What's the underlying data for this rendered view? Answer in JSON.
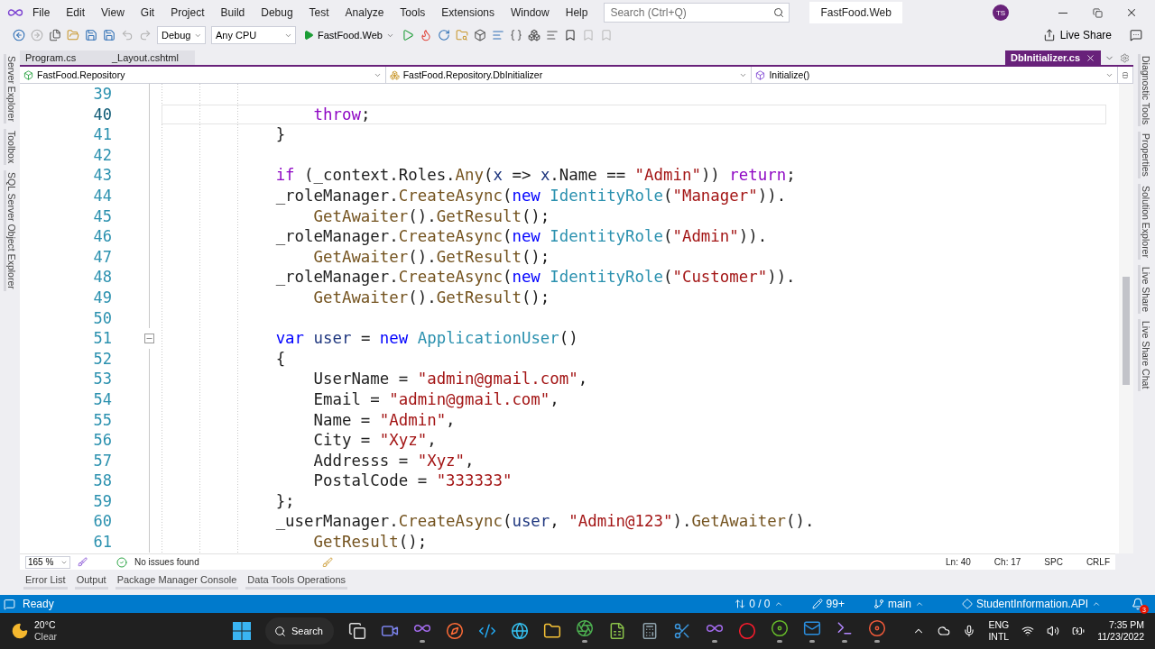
{
  "menu": [
    "File",
    "Edit",
    "View",
    "Git",
    "Project",
    "Build",
    "Debug",
    "Test",
    "Analyze",
    "Tools",
    "Extensions",
    "Window",
    "Help"
  ],
  "search": {
    "placeholder": "Search (Ctrl+Q)"
  },
  "solution_name": "FastFood.Web",
  "avatar": "TS",
  "toolbar": {
    "configuration": "Debug",
    "platform": "Any CPU",
    "run_target": "FastFood.Web",
    "live_share": "Live Share"
  },
  "left_tool_tabs": [
    "Server Explorer",
    "Toolbox",
    "SQL Server Object Explorer"
  ],
  "right_tool_tabs": [
    "Diagnostic Tools",
    "Properties",
    "Solution Explorer",
    "Live Share",
    "Live Share Chat"
  ],
  "document_tabs": [
    {
      "label": "Program.cs",
      "selected": false
    },
    {
      "label": "_Layout.cshtml",
      "selected": false
    },
    {
      "label": "DbInitializer.cs",
      "selected": true
    }
  ],
  "navigation_bar": {
    "project": "FastFood.Repository",
    "type": "FastFood.Repository.DbInitializer",
    "member": "Initialize()"
  },
  "editor": {
    "lines": [
      {
        "number": "39",
        "current": false,
        "collapsible": false
      },
      {
        "number": "40",
        "current": true,
        "collapsible": false,
        "tokens": [
          {
            "text": "                throw",
            "kind": "control"
          },
          {
            "text": ";",
            "kind": "plain"
          }
        ]
      },
      {
        "number": "41",
        "current": false,
        "collapsible": false,
        "tokens": [
          {
            "text": "            }",
            "kind": "plain"
          }
        ]
      },
      {
        "number": "42",
        "current": false,
        "collapsible": false
      },
      {
        "number": "43",
        "current": false,
        "collapsible": false,
        "tokens": [
          {
            "text": "            if",
            "kind": "control"
          },
          {
            "text": " (_context.Roles.",
            "kind": "plain"
          },
          {
            "text": "Any",
            "kind": "method"
          },
          {
            "text": "(",
            "kind": "plain"
          },
          {
            "text": "x",
            "kind": "local"
          },
          {
            "text": " => ",
            "kind": "plain"
          },
          {
            "text": "x",
            "kind": "local"
          },
          {
            "text": ".Name == ",
            "kind": "plain"
          },
          {
            "text": "\"Admin\"",
            "kind": "string"
          },
          {
            "text": ")) ",
            "kind": "plain"
          },
          {
            "text": "return",
            "kind": "control"
          },
          {
            "text": ";",
            "kind": "plain"
          }
        ]
      },
      {
        "number": "44",
        "current": false,
        "collapsible": false,
        "tokens": [
          {
            "text": "            _roleManager.",
            "kind": "plain"
          },
          {
            "text": "CreateAsync",
            "kind": "method"
          },
          {
            "text": "(",
            "kind": "plain"
          },
          {
            "text": "new",
            "kind": "keyword"
          },
          {
            "text": " IdentityRole",
            "kind": "type"
          },
          {
            "text": "(",
            "kind": "plain"
          },
          {
            "text": "\"Manager\"",
            "kind": "string"
          },
          {
            "text": ")).",
            "kind": "plain"
          }
        ]
      },
      {
        "number": "45",
        "current": false,
        "collapsible": false,
        "tokens": [
          {
            "text": "                GetAwaiter",
            "kind": "method"
          },
          {
            "text": "().",
            "kind": "plain"
          },
          {
            "text": "GetResult",
            "kind": "method"
          },
          {
            "text": "();",
            "kind": "plain"
          }
        ]
      },
      {
        "number": "46",
        "current": false,
        "collapsible": false,
        "tokens": [
          {
            "text": "            _roleManager.",
            "kind": "plain"
          },
          {
            "text": "CreateAsync",
            "kind": "method"
          },
          {
            "text": "(",
            "kind": "plain"
          },
          {
            "text": "new",
            "kind": "keyword"
          },
          {
            "text": " IdentityRole",
            "kind": "type"
          },
          {
            "text": "(",
            "kind": "plain"
          },
          {
            "text": "\"Admin\"",
            "kind": "string"
          },
          {
            "text": ")).",
            "kind": "plain"
          }
        ]
      },
      {
        "number": "47",
        "current": false,
        "collapsible": false,
        "tokens": [
          {
            "text": "                GetAwaiter",
            "kind": "method"
          },
          {
            "text": "().",
            "kind": "plain"
          },
          {
            "text": "GetResult",
            "kind": "method"
          },
          {
            "text": "();",
            "kind": "plain"
          }
        ]
      },
      {
        "number": "48",
        "current": false,
        "collapsible": false,
        "tokens": [
          {
            "text": "            _roleManager.",
            "kind": "plain"
          },
          {
            "text": "CreateAsync",
            "kind": "method"
          },
          {
            "text": "(",
            "kind": "plain"
          },
          {
            "text": "new",
            "kind": "keyword"
          },
          {
            "text": " IdentityRole",
            "kind": "type"
          },
          {
            "text": "(",
            "kind": "plain"
          },
          {
            "text": "\"Customer\"",
            "kind": "string"
          },
          {
            "text": ")).",
            "kind": "plain"
          }
        ]
      },
      {
        "number": "49",
        "current": false,
        "collapsible": false,
        "tokens": [
          {
            "text": "                GetAwaiter",
            "kind": "method"
          },
          {
            "text": "().",
            "kind": "plain"
          },
          {
            "text": "GetResult",
            "kind": "method"
          },
          {
            "text": "();",
            "kind": "plain"
          }
        ]
      },
      {
        "number": "50",
        "current": false,
        "collapsible": false
      },
      {
        "number": "51",
        "current": false,
        "collapsible": true,
        "tokens": [
          {
            "text": "            var",
            "kind": "keyword"
          },
          {
            "text": " user",
            "kind": "local"
          },
          {
            "text": " = ",
            "kind": "plain"
          },
          {
            "text": "new",
            "kind": "keyword"
          },
          {
            "text": " ApplicationUser",
            "kind": "type"
          },
          {
            "text": "()",
            "kind": "plain"
          }
        ]
      },
      {
        "number": "52",
        "current": false,
        "collapsible": false,
        "tokens": [
          {
            "text": "            {",
            "kind": "plain"
          }
        ]
      },
      {
        "number": "53",
        "current": false,
        "collapsible": false,
        "tokens": [
          {
            "text": "                UserName = ",
            "kind": "plain"
          },
          {
            "text": "\"admin@gmail.com\"",
            "kind": "string"
          },
          {
            "text": ",",
            "kind": "plain"
          }
        ]
      },
      {
        "number": "54",
        "current": false,
        "collapsible": false,
        "tokens": [
          {
            "text": "                Email = ",
            "kind": "plain"
          },
          {
            "text": "\"admin@gmail.com\"",
            "kind": "string"
          },
          {
            "text": ",",
            "kind": "plain"
          }
        ]
      },
      {
        "number": "55",
        "current": false,
        "collapsible": false,
        "tokens": [
          {
            "text": "                Name = ",
            "kind": "plain"
          },
          {
            "text": "\"Admin\"",
            "kind": "string"
          },
          {
            "text": ",",
            "kind": "plain"
          }
        ]
      },
      {
        "number": "56",
        "current": false,
        "collapsible": false,
        "tokens": [
          {
            "text": "                City = ",
            "kind": "plain"
          },
          {
            "text": "\"Xyz\"",
            "kind": "string"
          },
          {
            "text": ",",
            "kind": "plain"
          }
        ]
      },
      {
        "number": "57",
        "current": false,
        "collapsible": false,
        "tokens": [
          {
            "text": "                Addresss = ",
            "kind": "plain"
          },
          {
            "text": "\"Xyz\"",
            "kind": "string"
          },
          {
            "text": ",",
            "kind": "plain"
          }
        ]
      },
      {
        "number": "58",
        "current": false,
        "collapsible": false,
        "tokens": [
          {
            "text": "                PostalCode = ",
            "kind": "plain"
          },
          {
            "text": "\"333333\"",
            "kind": "string"
          }
        ]
      },
      {
        "number": "59",
        "current": false,
        "collapsible": false,
        "tokens": [
          {
            "text": "            };",
            "kind": "plain"
          }
        ]
      },
      {
        "number": "60",
        "current": false,
        "collapsible": false,
        "tokens": [
          {
            "text": "            _userManager.",
            "kind": "plain"
          },
          {
            "text": "CreateAsync",
            "kind": "method"
          },
          {
            "text": "(",
            "kind": "plain"
          },
          {
            "text": "user",
            "kind": "local"
          },
          {
            "text": ", ",
            "kind": "plain"
          },
          {
            "text": "\"Admin@123\"",
            "kind": "string"
          },
          {
            "text": ").",
            "kind": "plain"
          },
          {
            "text": "GetAwaiter",
            "kind": "method"
          },
          {
            "text": "().",
            "kind": "plain"
          }
        ]
      },
      {
        "number": "61",
        "current": false,
        "collapsible": false,
        "tokens": [
          {
            "text": "                GetResult",
            "kind": "method"
          },
          {
            "text": "();",
            "kind": "plain"
          }
        ]
      }
    ]
  },
  "editor_status": {
    "zoom": "165 %",
    "issues": "No issues found",
    "line": "Ln: 40",
    "column": "Ch: 17",
    "whitespace": "SPC",
    "line_endings": "CRLF"
  },
  "tool_tabs": [
    "Error List",
    "Output",
    "Package Manager Console",
    "Data Tools Operations"
  ],
  "status_bar": {
    "state": "Ready",
    "sync": "0 / 0",
    "changes": "99+",
    "branch": "main",
    "repository": "StudentInformation.API",
    "notifications": "3"
  },
  "taskbar": {
    "weather": {
      "temperature": "20°C",
      "condition": "Clear"
    },
    "search": "Search",
    "apps": [
      {
        "kind": "taskview",
        "running": false
      },
      {
        "kind": "chat",
        "running": false
      },
      {
        "kind": "studio",
        "running": true
      },
      {
        "kind": "compass",
        "running": false
      },
      {
        "kind": "code",
        "running": false
      },
      {
        "kind": "browser",
        "running": false
      },
      {
        "kind": "folder",
        "running": false
      },
      {
        "kind": "aperture",
        "running": true
      },
      {
        "kind": "sheet",
        "running": false
      },
      {
        "kind": "calculator",
        "running": false
      },
      {
        "kind": "scissors",
        "running": false
      },
      {
        "kind": "studio",
        "running": true
      },
      {
        "kind": "ring",
        "running": false
      },
      {
        "kind": "recorder",
        "running": true
      },
      {
        "kind": "mail",
        "running": true
      },
      {
        "kind": "terminal",
        "running": true
      },
      {
        "kind": "recorder_red",
        "running": true
      }
    ],
    "language": "ENG",
    "layout": "INTL",
    "time": "7:35 PM",
    "date": "11/23/2022"
  }
}
